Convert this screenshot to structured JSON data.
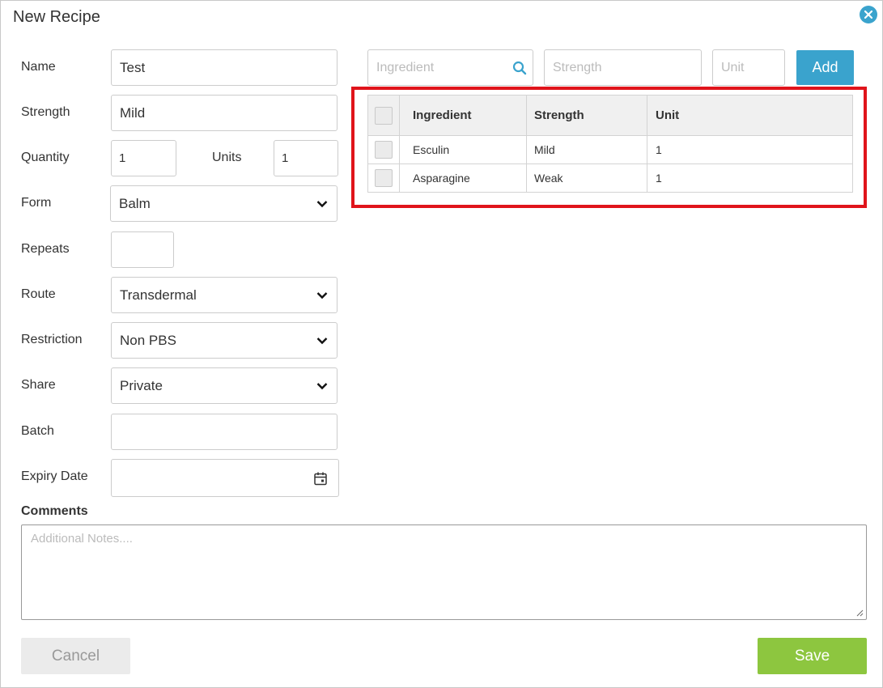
{
  "dialog": {
    "title": "New Recipe"
  },
  "form": {
    "name": {
      "label": "Name",
      "value": "Test"
    },
    "strength": {
      "label": "Strength",
      "value": "Mild"
    },
    "quantity": {
      "label": "Quantity",
      "value": "1"
    },
    "units": {
      "label": "Units",
      "value": "1"
    },
    "form": {
      "label": "Form",
      "value": "Balm"
    },
    "repeats": {
      "label": "Repeats",
      "value": ""
    },
    "route": {
      "label": "Route",
      "value": "Transdermal"
    },
    "restriction": {
      "label": "Restriction",
      "value": "Non PBS"
    },
    "share": {
      "label": "Share",
      "value": "Private"
    },
    "batch": {
      "label": "Batch",
      "value": ""
    },
    "expiry_date": {
      "label": "Expiry Date",
      "value": ""
    },
    "comments": {
      "label": "Comments",
      "placeholder": "Additional Notes...."
    }
  },
  "ingredient_entry": {
    "ingredient_placeholder": "Ingredient",
    "strength_placeholder": "Strength",
    "unit_placeholder": "Unit",
    "add_label": "Add"
  },
  "ingredients_table": {
    "columns": [
      "Ingredient",
      "Strength",
      "Unit"
    ],
    "rows": [
      {
        "ingredient": "Esculin",
        "strength": "Mild",
        "unit": "1"
      },
      {
        "ingredient": "Asparagine",
        "strength": "Weak",
        "unit": "1"
      }
    ]
  },
  "footer": {
    "cancel_label": "Cancel",
    "save_label": "Save"
  },
  "colors": {
    "accent": "#3aa3cd",
    "save": "#8dc63f",
    "highlight": "#e0141b"
  },
  "icons": {
    "close": "close-icon",
    "search": "search-icon",
    "dropdown": "chevron-down-icon",
    "calendar": "calendar-icon"
  }
}
